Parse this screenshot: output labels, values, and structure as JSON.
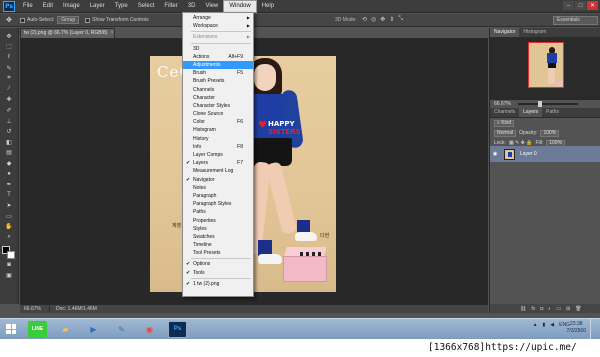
{
  "menubar": {
    "logo": "Ps",
    "items": [
      "File",
      "Edit",
      "Image",
      "Layer",
      "Type",
      "Select",
      "Filter",
      "3D",
      "View",
      "Window",
      "Help"
    ],
    "active": "Window"
  },
  "options_bar": {
    "auto_select_label": "Auto-Select:",
    "auto_select_value": "Group",
    "show_transform_label": "Show Transform Controls",
    "mode_3d_label": "3D Mode:",
    "workspace": "Essentials"
  },
  "document": {
    "tab_title": "tw (2).png @ 66.7% (Layer 0, RGB/8)",
    "zoom": "66.67%",
    "doc_size": "Doc: 1.46M/1.46M"
  },
  "artwork": {
    "magazine_text": "CeCi",
    "logo_line1": "HAPPY",
    "logo_line2": "SISTERS",
    "caption_left": "제영",
    "caption_right": "다현"
  },
  "window_menu": {
    "items": [
      {
        "label": "Arrange",
        "type": "submenu"
      },
      {
        "label": "Workspace",
        "type": "submenu"
      },
      {
        "type": "separator"
      },
      {
        "label": "Extensions",
        "type": "submenu",
        "disabled": true
      },
      {
        "type": "separator"
      },
      {
        "label": "3D"
      },
      {
        "label": "Actions",
        "shortcut": "Alt+F9"
      },
      {
        "label": "Adjustments",
        "highlight": true
      },
      {
        "label": "Brush",
        "shortcut": "F5"
      },
      {
        "label": "Brush Presets"
      },
      {
        "label": "Channels"
      },
      {
        "label": "Character"
      },
      {
        "label": "Character Styles"
      },
      {
        "label": "Clone Source"
      },
      {
        "label": "Color",
        "shortcut": "F6"
      },
      {
        "label": "Histogram"
      },
      {
        "label": "History"
      },
      {
        "label": "Info",
        "shortcut": "F8"
      },
      {
        "label": "Layer Comps"
      },
      {
        "label": "Layers",
        "shortcut": "F7",
        "checked": true
      },
      {
        "label": "Measurement Log"
      },
      {
        "label": "Navigator",
        "checked": true
      },
      {
        "label": "Notes"
      },
      {
        "label": "Paragraph"
      },
      {
        "label": "Paragraph Styles"
      },
      {
        "label": "Paths"
      },
      {
        "label": "Properties"
      },
      {
        "label": "Styles"
      },
      {
        "label": "Swatches"
      },
      {
        "label": "Timeline"
      },
      {
        "label": "Tool Presets"
      },
      {
        "type": "separator"
      },
      {
        "label": "Options",
        "checked": true
      },
      {
        "label": "Tools",
        "checked": true
      },
      {
        "type": "separator"
      },
      {
        "label": "1 tw (2).png",
        "checked": true
      }
    ]
  },
  "panels": {
    "top_tabs": [
      "Navigator",
      "Histogram"
    ],
    "navigator_zoom": "66.67%",
    "mid_tabs": [
      "Channels",
      "Layers",
      "Paths"
    ],
    "kind_label": "Kind",
    "blend_mode": "Normal",
    "opacity_label": "Opacity:",
    "opacity_value": "100%",
    "lock_label": "Lock:",
    "fill_label": "Fill:",
    "fill_value": "100%",
    "layer_name": "Layer 0"
  },
  "taskbar": {
    "apps": [
      "LINE",
      "File Explorer",
      "Media Player",
      "Paint",
      "Google Chrome",
      "Photoshop"
    ],
    "language": "ENG",
    "time": "23:38",
    "date": "7/3/2560"
  },
  "watermark": "[1366x768]https://upic.me/",
  "colors": {
    "menu_highlight": "#3399ff",
    "layer_selected": "#6b7b98",
    "ps_blue": "#31a8ff"
  }
}
